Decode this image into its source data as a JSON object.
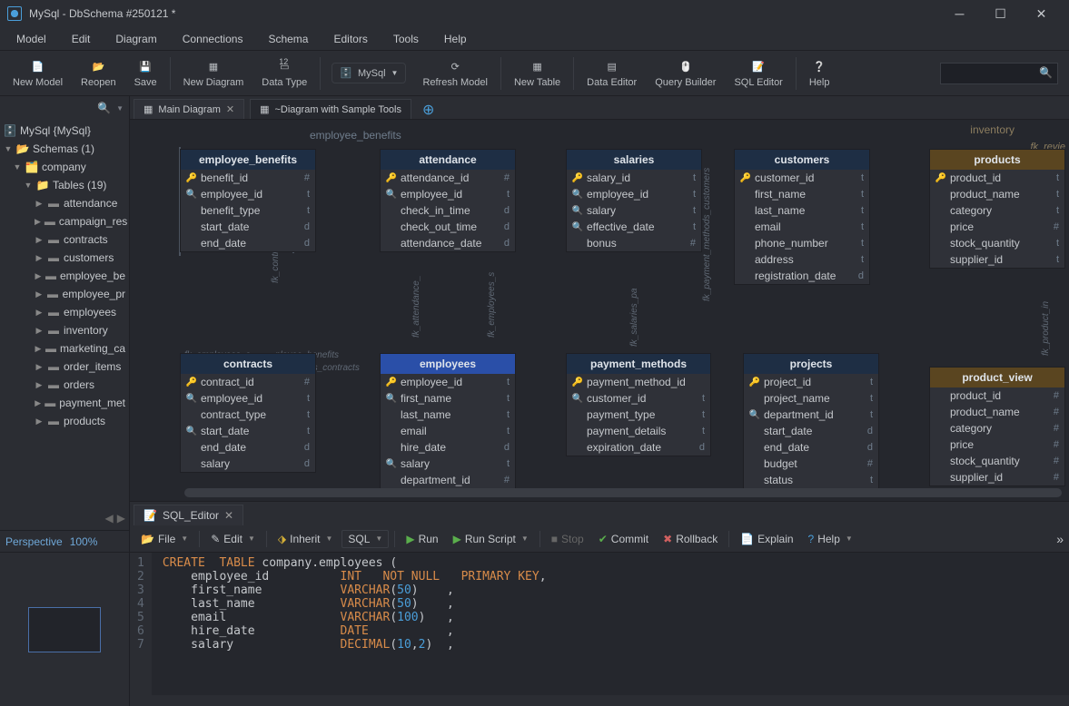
{
  "title": "MySql - DbSchema #250121 *",
  "menus": [
    "Model",
    "Edit",
    "Diagram",
    "Connections",
    "Schema",
    "Editors",
    "Tools",
    "Help"
  ],
  "toolbar": {
    "newModel": "New Model",
    "reopen": "Reopen",
    "save": "Save",
    "newDiagram": "New Diagram",
    "dataType": "Data Type",
    "dataTypeBadge": "12",
    "mysql": "MySql",
    "refreshModel": "Refresh Model",
    "newTable": "New Table",
    "dataEditor": "Data Editor",
    "queryBuilder": "Query Builder",
    "sqlEditor": "SQL Editor",
    "help": "Help"
  },
  "sidebar": {
    "root": "MySql {MySql}",
    "schemas": "Schemas (1)",
    "company": "company",
    "tables": "Tables (19)",
    "items": [
      "attendance",
      "campaign_res",
      "contracts",
      "customers",
      "employee_be",
      "employee_pr",
      "employees",
      "inventory",
      "marketing_ca",
      "order_items",
      "orders",
      "payment_met",
      "products"
    ]
  },
  "perspective": {
    "label": "Perspective",
    "pct": "100%"
  },
  "diagTabs": {
    "main": "Main Diagram",
    "sample": "~Diagram with Sample Tools"
  },
  "canvas": {
    "schemaLabel": "employee_benefits",
    "inventory": "inventory",
    "fkRev": "fk_revie",
    "fk": {
      "contracts_sa": "fk_contracts_sa",
      "employees_benefits": "fk_employees_e",
      "employee_benefits2": "ployee_benefits",
      "byees_contracts": "byees_contracts",
      "attendance": "fk_attendance_",
      "employees_s": "fk_employees_s",
      "salaries": "fk_salaries_pa",
      "pm_customers": "fk_payment_methods_customers",
      "product_in": "fk_product_in"
    },
    "tables": {
      "employee_benefits": {
        "title": "employee_benefits",
        "cols": [
          {
            "i": "k",
            "n": "benefit_id",
            "t": "#"
          },
          {
            "i": "s",
            "n": "employee_id",
            "t": "t"
          },
          {
            "i": "",
            "n": "benefit_type",
            "t": "t"
          },
          {
            "i": "",
            "n": "start_date",
            "t": "d"
          },
          {
            "i": "",
            "n": "end_date",
            "t": "d"
          }
        ]
      },
      "attendance": {
        "title": "attendance",
        "cols": [
          {
            "i": "k",
            "n": "attendance_id",
            "t": "#"
          },
          {
            "i": "s",
            "n": "employee_id",
            "t": "t"
          },
          {
            "i": "",
            "n": "check_in_time",
            "t": "d"
          },
          {
            "i": "",
            "n": "check_out_time",
            "t": "d"
          },
          {
            "i": "",
            "n": "attendance_date",
            "t": "d"
          }
        ]
      },
      "salaries": {
        "title": "salaries",
        "cols": [
          {
            "i": "k",
            "n": "salary_id",
            "t": "t"
          },
          {
            "i": "s",
            "n": "employee_id",
            "t": "t"
          },
          {
            "i": "s",
            "n": "salary",
            "t": "t"
          },
          {
            "i": "s",
            "n": "effective_date",
            "t": "t"
          },
          {
            "i": "",
            "n": "bonus",
            "t": "#"
          }
        ]
      },
      "customers": {
        "title": "customers",
        "cols": [
          {
            "i": "k",
            "n": "customer_id",
            "t": "t"
          },
          {
            "i": "",
            "n": "first_name",
            "t": "t"
          },
          {
            "i": "",
            "n": "last_name",
            "t": "t"
          },
          {
            "i": "",
            "n": "email",
            "t": "t"
          },
          {
            "i": "",
            "n": "phone_number",
            "t": "t"
          },
          {
            "i": "",
            "n": "address",
            "t": "t"
          },
          {
            "i": "",
            "n": "registration_date",
            "t": "d"
          }
        ]
      },
      "products": {
        "title": "products",
        "cols": [
          {
            "i": "k",
            "n": "product_id",
            "t": "t"
          },
          {
            "i": "",
            "n": "product_name",
            "t": "t"
          },
          {
            "i": "",
            "n": "category",
            "t": "t"
          },
          {
            "i": "",
            "n": "price",
            "t": "#"
          },
          {
            "i": "",
            "n": "stock_quantity",
            "t": "t"
          },
          {
            "i": "",
            "n": "supplier_id",
            "t": "t"
          }
        ]
      },
      "contracts": {
        "title": "contracts",
        "cols": [
          {
            "i": "k",
            "n": "contract_id",
            "t": "#"
          },
          {
            "i": "s",
            "n": "employee_id",
            "t": "t"
          },
          {
            "i": "",
            "n": "contract_type",
            "t": "t"
          },
          {
            "i": "s",
            "n": "start_date",
            "t": "t"
          },
          {
            "i": "",
            "n": "end_date",
            "t": "d"
          },
          {
            "i": "",
            "n": "salary",
            "t": "d"
          }
        ]
      },
      "employees": {
        "title": "employees",
        "cols": [
          {
            "i": "k",
            "n": "employee_id",
            "t": "t"
          },
          {
            "i": "s",
            "n": "first_name",
            "t": "t"
          },
          {
            "i": "",
            "n": "last_name",
            "t": "t"
          },
          {
            "i": "",
            "n": "email",
            "t": "t"
          },
          {
            "i": "",
            "n": "hire_date",
            "t": "d"
          },
          {
            "i": "s",
            "n": "salary",
            "t": "t"
          },
          {
            "i": "",
            "n": "department_id",
            "t": "#"
          }
        ]
      },
      "payment_methods": {
        "title": "payment_methods",
        "cols": [
          {
            "i": "k",
            "n": "payment_method_id",
            "t": ""
          },
          {
            "i": "s",
            "n": "customer_id",
            "t": "t"
          },
          {
            "i": "",
            "n": "payment_type",
            "t": "t"
          },
          {
            "i": "",
            "n": "payment_details",
            "t": "t"
          },
          {
            "i": "",
            "n": "expiration_date",
            "t": "d"
          }
        ]
      },
      "projects": {
        "title": "projects",
        "cols": [
          {
            "i": "k",
            "n": "project_id",
            "t": "t"
          },
          {
            "i": "",
            "n": "project_name",
            "t": "t"
          },
          {
            "i": "s",
            "n": "department_id",
            "t": "t"
          },
          {
            "i": "",
            "n": "start_date",
            "t": "d"
          },
          {
            "i": "",
            "n": "end_date",
            "t": "d"
          },
          {
            "i": "",
            "n": "budget",
            "t": "#"
          },
          {
            "i": "",
            "n": "status",
            "t": "t"
          }
        ]
      },
      "product_view": {
        "title": "product_view",
        "cols": [
          {
            "i": "",
            "n": "product_id",
            "t": "#"
          },
          {
            "i": "",
            "n": "product_name",
            "t": "#"
          },
          {
            "i": "",
            "n": "category",
            "t": "#"
          },
          {
            "i": "",
            "n": "price",
            "t": "#"
          },
          {
            "i": "",
            "n": "stock_quantity",
            "t": "#"
          },
          {
            "i": "",
            "n": "supplier_id",
            "t": "#"
          }
        ]
      }
    }
  },
  "sqlPanel": {
    "tab": "SQL_Editor",
    "tb": {
      "file": "File",
      "edit": "Edit",
      "inherit": "Inherit",
      "sql": "SQL",
      "run": "Run",
      "runScript": "Run Script",
      "stop": "Stop",
      "commit": "Commit",
      "rollback": "Rollback",
      "explain": "Explain",
      "help": "Help"
    },
    "lines": [
      {
        "n": "1",
        "html": "<span class='kw'>CREATE</span>&nbsp;&nbsp;<span class='kw'>TABLE</span> <span class='id'>company.employees</span> <span class='pu'>(</span>"
      },
      {
        "n": "2",
        "html": "&nbsp;&nbsp;&nbsp;&nbsp;<span class='id'>employee_id</span>&nbsp;&nbsp;&nbsp;&nbsp;&nbsp;&nbsp;&nbsp;&nbsp;&nbsp;&nbsp;<span class='ty'>INT</span>&nbsp;&nbsp;&nbsp;<span class='ty'>NOT NULL</span>&nbsp;&nbsp;&nbsp;<span class='ty'>PRIMARY KEY</span><span class='pu'>,</span>"
      },
      {
        "n": "3",
        "html": "&nbsp;&nbsp;&nbsp;&nbsp;<span class='id'>first_name</span>&nbsp;&nbsp;&nbsp;&nbsp;&nbsp;&nbsp;&nbsp;&nbsp;&nbsp;&nbsp;&nbsp;<span class='ty'>VARCHAR</span><span class='pu'>(</span><span class='num'>50</span><span class='pu'>)</span>&nbsp;&nbsp;&nbsp;&nbsp;<span class='pu'>,</span>"
      },
      {
        "n": "4",
        "html": "&nbsp;&nbsp;&nbsp;&nbsp;<span class='id'>last_name</span>&nbsp;&nbsp;&nbsp;&nbsp;&nbsp;&nbsp;&nbsp;&nbsp;&nbsp;&nbsp;&nbsp;&nbsp;<span class='ty'>VARCHAR</span><span class='pu'>(</span><span class='num'>50</span><span class='pu'>)</span>&nbsp;&nbsp;&nbsp;&nbsp;<span class='pu'>,</span>"
      },
      {
        "n": "5",
        "html": "&nbsp;&nbsp;&nbsp;&nbsp;<span class='id'>email</span>&nbsp;&nbsp;&nbsp;&nbsp;&nbsp;&nbsp;&nbsp;&nbsp;&nbsp;&nbsp;&nbsp;&nbsp;&nbsp;&nbsp;&nbsp;&nbsp;<span class='ty'>VARCHAR</span><span class='pu'>(</span><span class='num'>100</span><span class='pu'>)</span>&nbsp;&nbsp;&nbsp;<span class='pu'>,</span>"
      },
      {
        "n": "6",
        "html": "&nbsp;&nbsp;&nbsp;&nbsp;<span class='id'>hire_date</span>&nbsp;&nbsp;&nbsp;&nbsp;&nbsp;&nbsp;&nbsp;&nbsp;&nbsp;&nbsp;&nbsp;&nbsp;<span class='ty'>DATE</span>&nbsp;&nbsp;&nbsp;&nbsp;&nbsp;&nbsp;&nbsp;&nbsp;&nbsp;&nbsp;&nbsp;<span class='pu'>,</span>"
      },
      {
        "n": "7",
        "html": "&nbsp;&nbsp;&nbsp;&nbsp;<span class='id'>salary</span>&nbsp;&nbsp;&nbsp;&nbsp;&nbsp;&nbsp;&nbsp;&nbsp;&nbsp;&nbsp;&nbsp;&nbsp;&nbsp;&nbsp;&nbsp;<span class='ty'>DECIMAL</span><span class='pu'>(</span><span class='num'>10</span><span class='pu'>,</span><span class='num'>2</span><span class='pu'>)</span>&nbsp;&nbsp;<span class='pu'>,</span>"
      }
    ]
  }
}
